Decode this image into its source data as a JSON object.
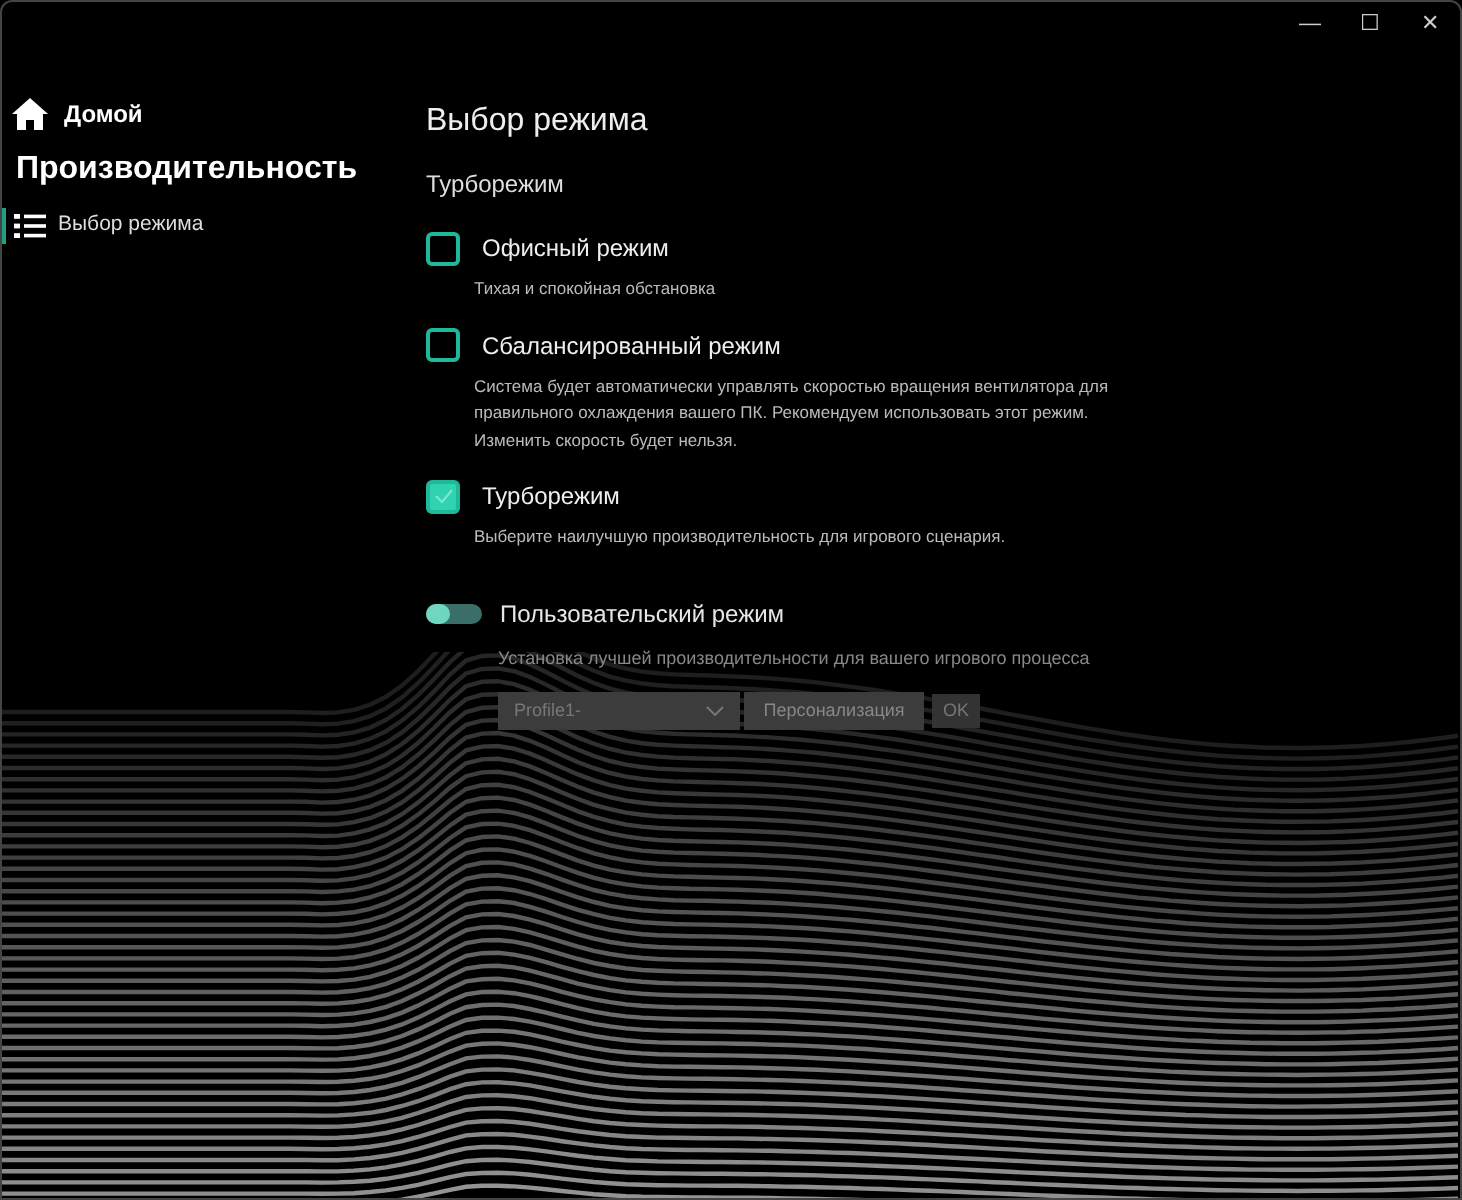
{
  "window": {
    "controls": [
      "—",
      "☐",
      "✕"
    ]
  },
  "sidebar": {
    "home": "Домой",
    "section": "Производительность",
    "items": [
      {
        "label": "Выбор режима",
        "selected": true
      }
    ]
  },
  "page": {
    "title": "Выбор режима",
    "current_mode": "Турборежим",
    "modes": [
      {
        "label": "Офисный режим",
        "description": "Тихая и спокойная обстановка",
        "checked": false
      },
      {
        "label": "Сбалансированный режим",
        "description": "Система будет автоматически управлять скоростью вращения вентилятора для правильного охлаждения вашего ПК. Рекомендуем использовать этот режим. Изменить скорость будет нельзя.",
        "checked": false
      },
      {
        "label": "Турборежим",
        "description": "Выберите наилучшую производительность для игрового сценария.",
        "checked": true
      }
    ],
    "custom": {
      "label": "Пользовательский режим",
      "description": "Установка лучшей производительности для вашего игрового процесса",
      "on": false,
      "profile": {
        "value": "Profile1-",
        "disabled": true
      },
      "personalize": {
        "label": "Персонализация",
        "disabled": true
      },
      "ok": {
        "label": "OK",
        "disabled": true
      }
    }
  }
}
